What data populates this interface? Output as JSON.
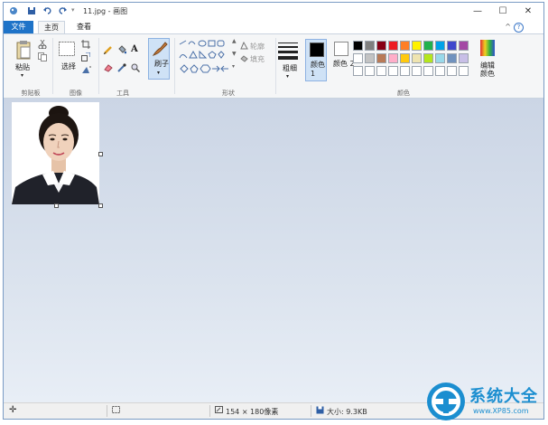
{
  "window": {
    "title": "11.jpg - 画图",
    "controls": {
      "minimize": "—",
      "maximize": "☐",
      "close": "✕"
    }
  },
  "tabs": [
    {
      "label": "文件"
    },
    {
      "label": "主页"
    },
    {
      "label": "查看"
    }
  ],
  "ribbon": {
    "clipboard": {
      "paste_label": "粘贴",
      "group_label": "剪贴板"
    },
    "image": {
      "select_label": "选择",
      "group_label": "图像"
    },
    "tools": {
      "group_label": "工具",
      "text_tool": "A"
    },
    "brushes": {
      "label": "刷子"
    },
    "shapes": {
      "outline_label": "轮廓",
      "fill_label": "填充",
      "group_label": "形状"
    },
    "size": {
      "label": "粗细"
    },
    "colors": {
      "color1_label": "颜色 1",
      "color2_label": "颜色 2",
      "edit_label": "编辑颜色",
      "group_label": "颜色",
      "color1": "#000000",
      "color2": "#ffffff",
      "palette_row1": [
        "#000000",
        "#7f7f7f",
        "#880015",
        "#ed1c24",
        "#ff7f27",
        "#fff200",
        "#22b14c",
        "#00a2e8",
        "#3f48cc",
        "#a349a4"
      ],
      "palette_row2": [
        "#ffffff",
        "#c3c3c3",
        "#b97a57",
        "#ffaec9",
        "#ffc90e",
        "#efe4b0",
        "#b5e61d",
        "#99d9ea",
        "#7092be",
        "#c8bfe7"
      ],
      "palette_row3": [
        "#ffffff",
        "#ffffff",
        "#ffffff",
        "#ffffff",
        "#ffffff",
        "#ffffff",
        "#ffffff",
        "#ffffff",
        "#ffffff",
        "#ffffff"
      ]
    }
  },
  "status": {
    "image_size": "154 × 180像素",
    "file_size": "大小: 9.3KB"
  },
  "watermark": {
    "brand": "系统大全",
    "url": "www.XP85.com"
  }
}
